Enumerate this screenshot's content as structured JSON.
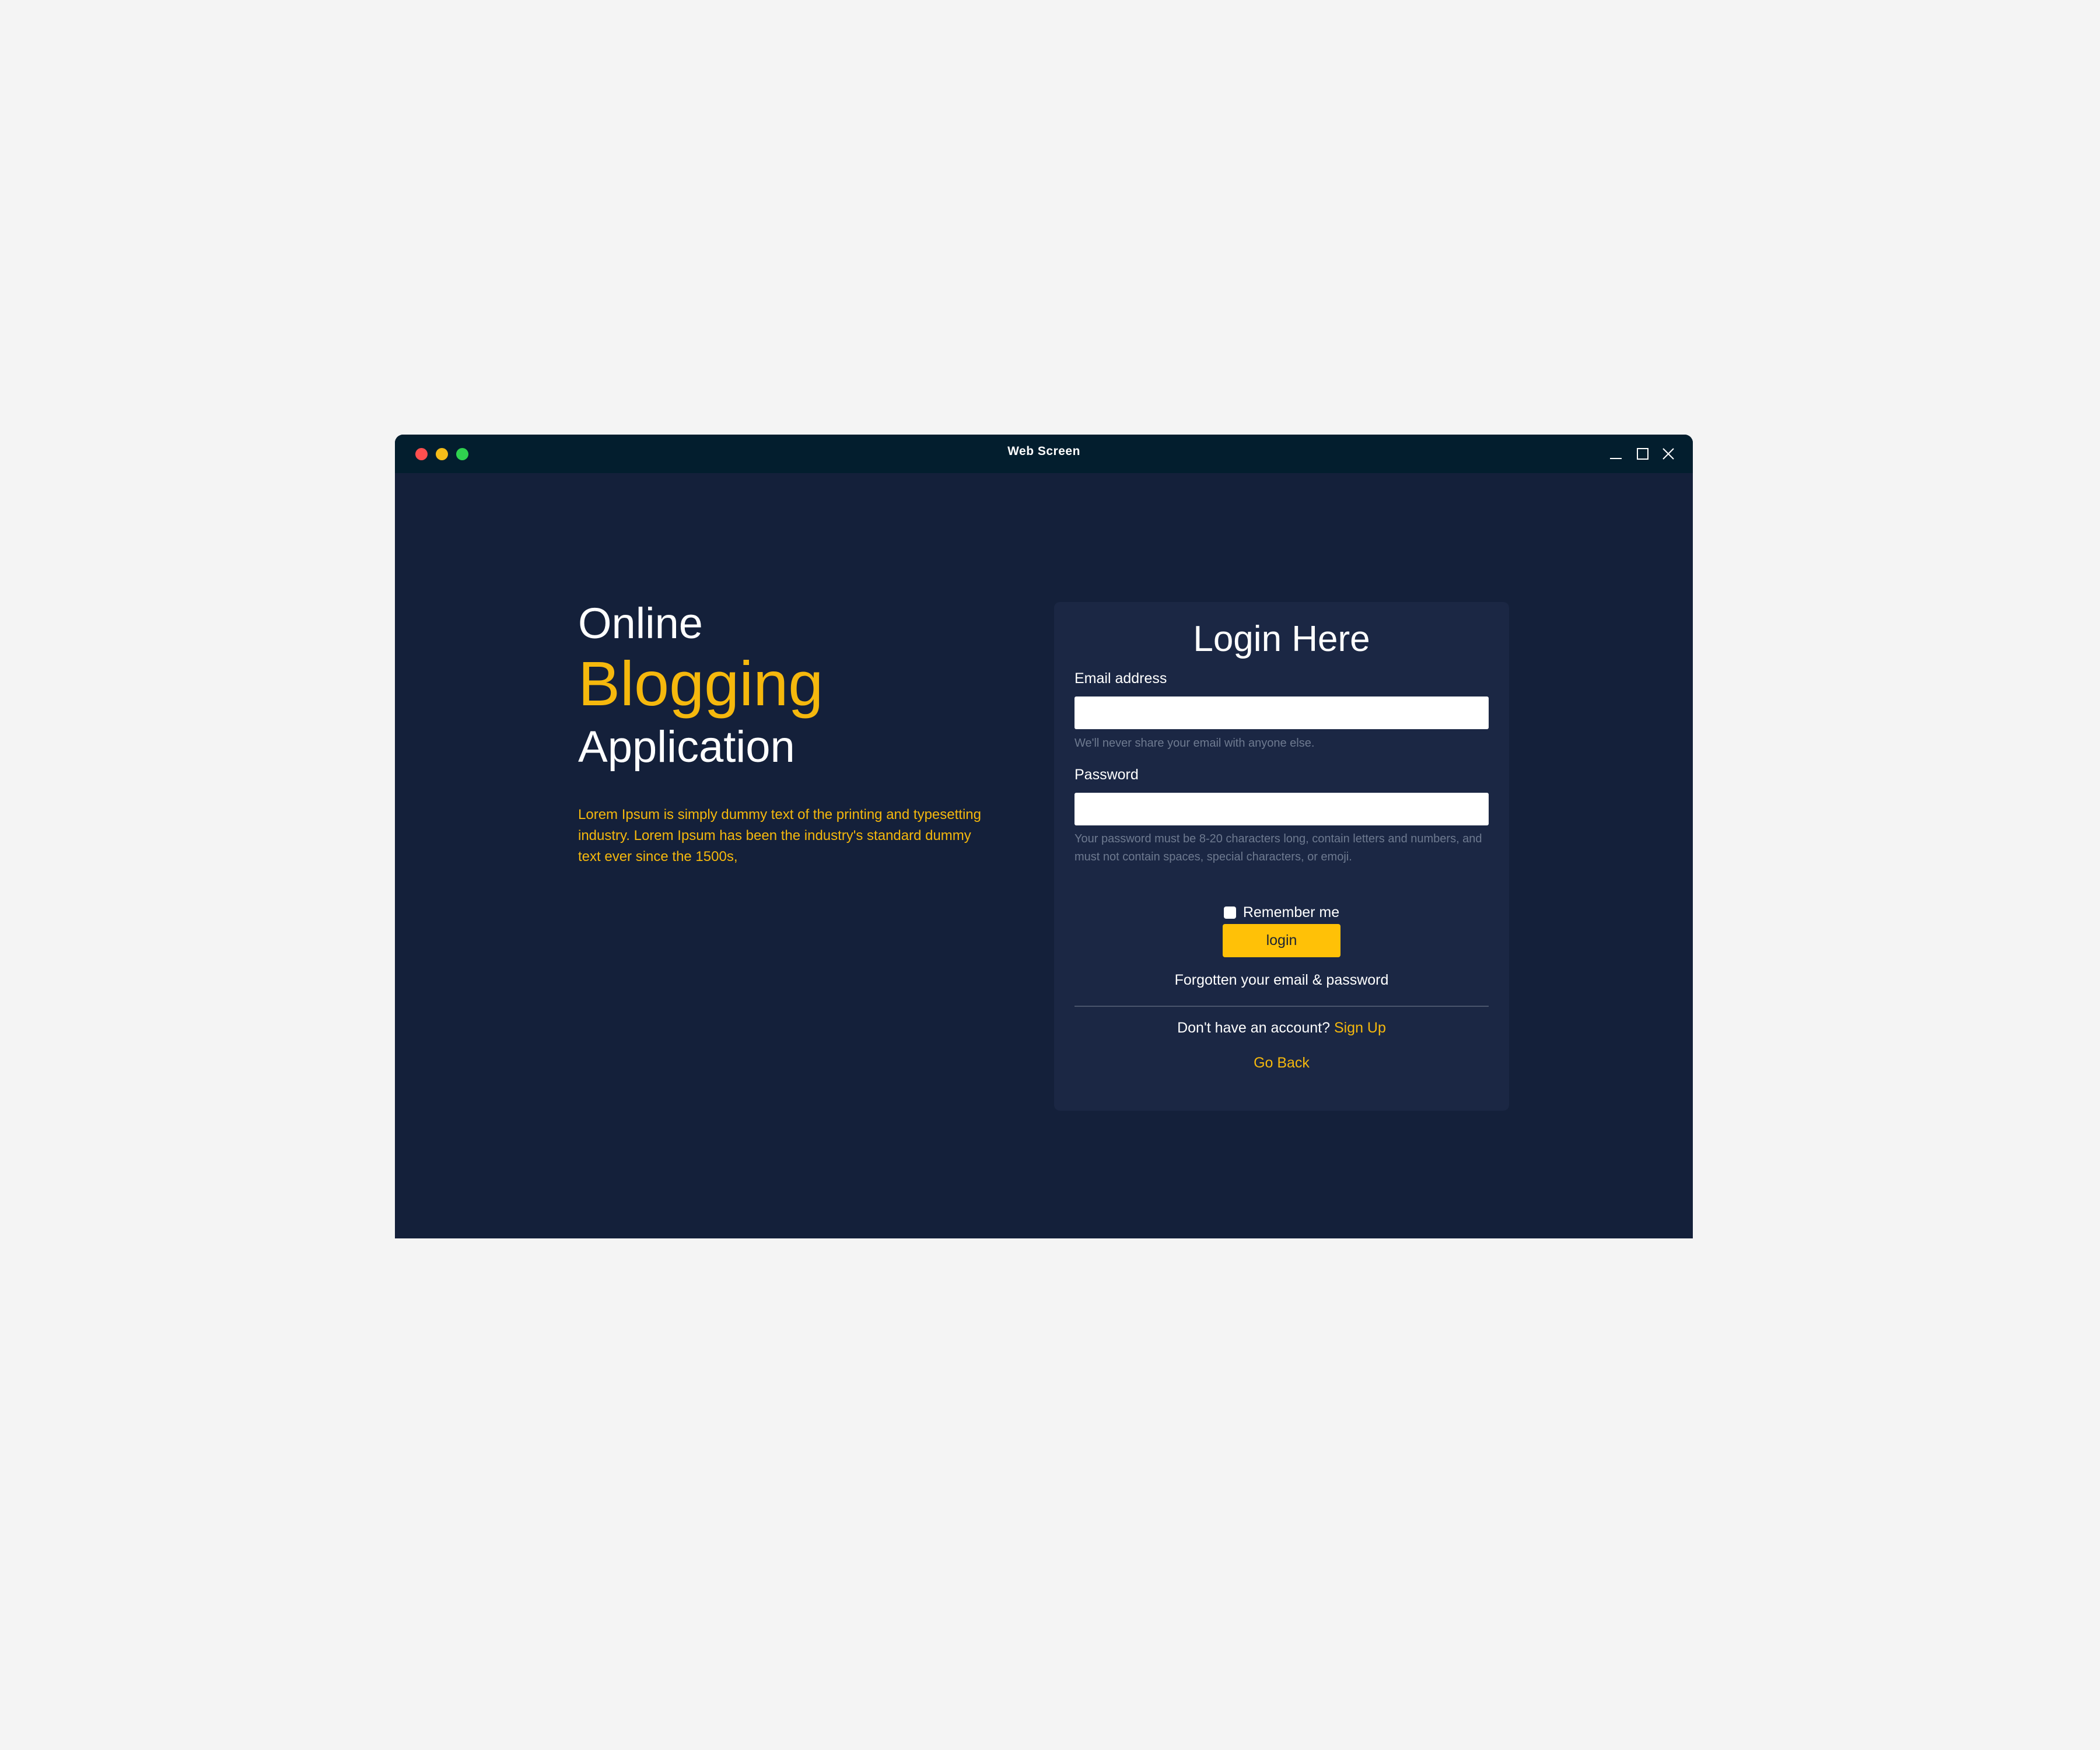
{
  "window": {
    "title": "Web Screen",
    "controls": {
      "close_icon": "circle-red",
      "minimize_icon": "circle-yellow",
      "maximize_icon": "circle-green"
    }
  },
  "hero": {
    "line1": "Online",
    "line2": "Blogging",
    "line3": "Application",
    "description": "Lorem Ipsum is simply dummy text of the printing and typesetting industry. Lorem Ipsum has been the industry's standard dummy text ever since the 1500s,"
  },
  "login": {
    "title": "Login Here",
    "email_label": "Email address",
    "email_value": "",
    "email_hint": "We'll never share your email with anyone else.",
    "password_label": "Password",
    "password_value": "",
    "password_hint": "Your password must be 8-20 characters long, contain letters and numbers, and must not contain spaces, special characters, or emoji.",
    "remember_label": "Remember me",
    "login_button": "login",
    "forgot_link": "Forgotten your email & password",
    "no_account_text": "Don't have an account?",
    "signup_link": "Sign Up",
    "go_back_link": "Go Back"
  },
  "colors": {
    "page_background": "#f4f4f4",
    "window_background": "#14203a",
    "titlebar": "#031e2e",
    "card": "#1b2744",
    "accent": "#f5b80d",
    "button": "#ffc107"
  }
}
